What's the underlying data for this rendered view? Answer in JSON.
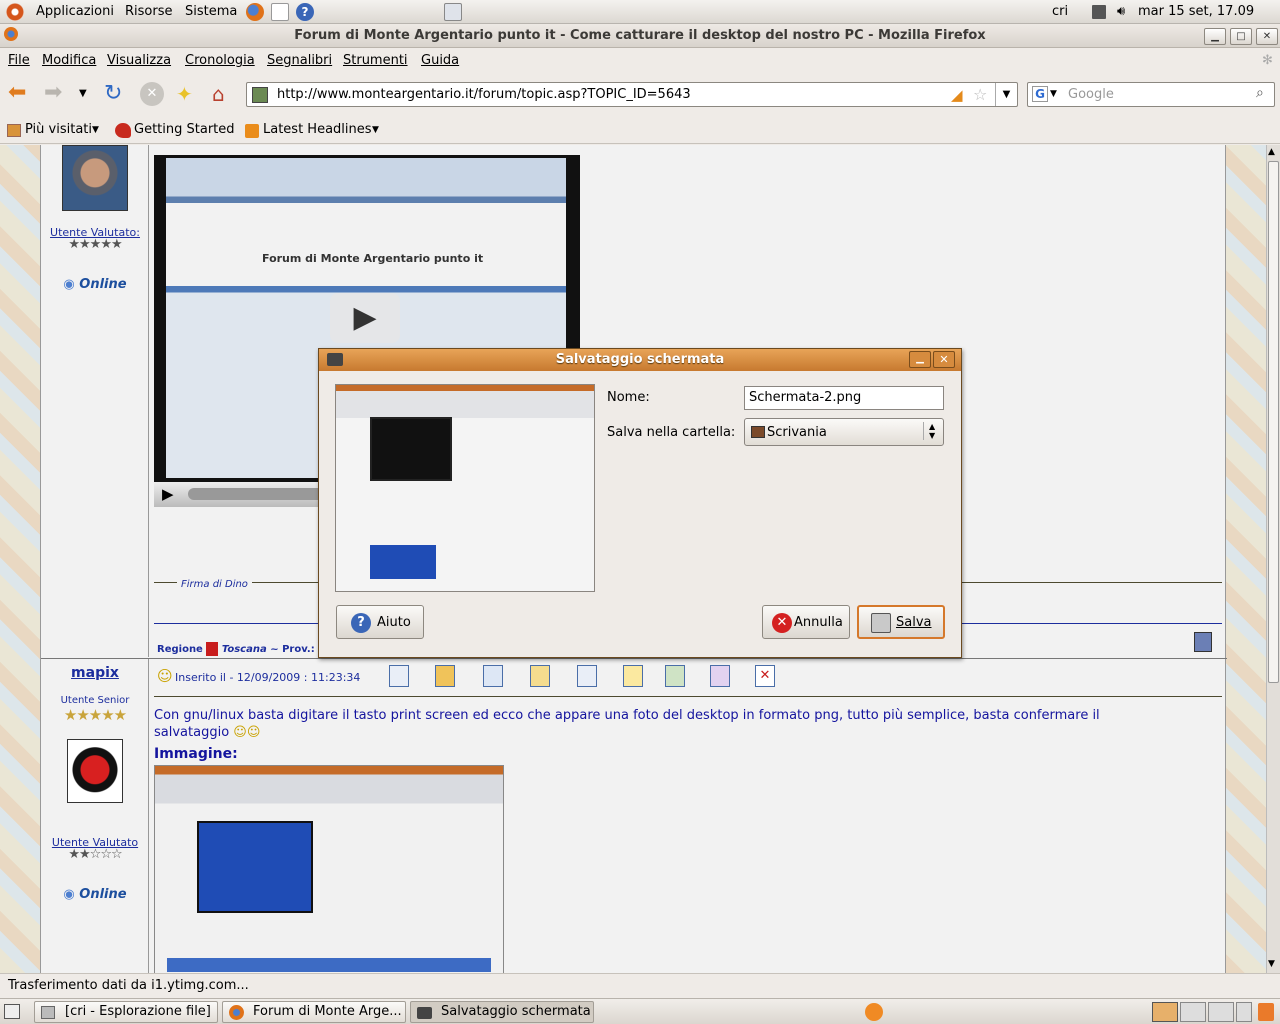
{
  "panel": {
    "menu_applications": "Applicazioni",
    "menu_places": "Risorse",
    "menu_system": "Sistema",
    "user": "cri",
    "clock": "mar 15 set, 17.09"
  },
  "window": {
    "title": "Forum di Monte Argentario punto it - Come catturare il desktop del nostro PC - Mozilla Firefox"
  },
  "menubar": {
    "items": [
      "File",
      "Modifica",
      "Visualizza",
      "Cronologia",
      "Segnalibri",
      "Strumenti",
      "Guida"
    ]
  },
  "navigation": {
    "url": "http://www.monteargentario.it/forum/topic.asp?TOPIC_ID=5643",
    "search_placeholder": "Google"
  },
  "bookmarks": {
    "items": [
      "Più visitati",
      "Getting Started",
      "Latest Headlines"
    ]
  },
  "post1": {
    "user_rated": "Utente Valutato:",
    "stars": "★★★★★",
    "online": "Online",
    "signature": "Firma di Dino",
    "region_label": "Regione",
    "region": "Toscana",
    "prov_label": "~ Prov.: Gro"
  },
  "post2": {
    "username": "mapix",
    "rank": "Utente Senior",
    "rank_stars": "★★★★★",
    "user_rated": "Utente Valutato",
    "rated_stars": "★★☆☆☆",
    "online": "Online",
    "inserted": "Inserito il - 12/09/2009 : 11:23:34",
    "body": "Con gnu/linux basta digitare il tasto print screen ed ecco che appare una foto del desktop in formato png, tutto più semplice, basta confermare il salvataggio",
    "image_label": "Immagine:"
  },
  "dialog": {
    "title": "Salvataggio schermata",
    "name_label": "Nome:",
    "name_value": "Schermata-2.png",
    "folder_label": "Salva nella cartella:",
    "folder_value": "Scrivania",
    "help_button": "Aiuto",
    "cancel_button": "Annulla",
    "save_button": "Salva"
  },
  "status": {
    "text": "Trasferimento dati da i1.ytimg.com..."
  },
  "taskbar": {
    "items": [
      "[cri - Esplorazione file]",
      "Forum di Monte Arge...",
      "Salvataggio schermata"
    ]
  },
  "colors": {
    "dialog_title": "#d58a3d",
    "link_blue": "#1d2e9e",
    "online_blue": "#1d4f9e"
  }
}
